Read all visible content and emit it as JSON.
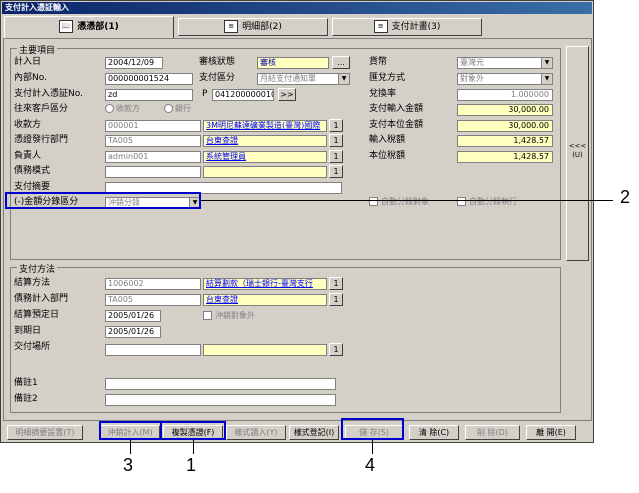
{
  "window": {
    "title": "支付計入憑証輸入"
  },
  "tabs": [
    {
      "label": "憑憑部(1)",
      "icon": "book-icon"
    },
    {
      "label": "明細部(2)",
      "icon": "document-icon"
    },
    {
      "label": "支付計畫(3)",
      "icon": "document-icon"
    }
  ],
  "main_group": {
    "title": "主要項目",
    "labels": {
      "entry_date": "計入日",
      "internal_no": "內部No.",
      "payment_no": "支付計入憑証No.",
      "trade_dist": "往來客戶區分",
      "payee": "收款方",
      "dept": "憑證發行部門",
      "person": "負責人",
      "voucher_mode": "債務模式",
      "summary": "支付摘要",
      "split": "(-)金額分錄區分",
      "review": "審核狀態",
      "pay_dist": "支付區分",
      "p": "P",
      "currency": "貨幣",
      "fx_method": "匯兌方式",
      "fx_rate": "兌換率",
      "pay_amount": "支付輸入金額",
      "local_amount": "支付本位金額",
      "input_tax": "輸入稅額",
      "local_tax": "本位稅額"
    },
    "values": {
      "entry_date": "2004/12/09",
      "internal_no": "000000001524",
      "payment_no": "zd",
      "trade_radio_1": "收款方",
      "trade_radio_2": "銀行",
      "payee_code": "000001",
      "payee_name": "3M明尼蘇達礦業製造(臺灣)國際",
      "dept_code": "TA005",
      "dept_name": "台東查證",
      "person_code": "admin001",
      "person_name": "系統管理員",
      "voucher_mode": "",
      "summary": "",
      "split": "沖銷分錄",
      "review": "審核",
      "pay_dist": "月結支付通知單",
      "p_value": "041200000010",
      "currency": "臺灣元",
      "fx_method": "對象外",
      "fx_rate": "1.000000",
      "pay_amount": "30,000.00",
      "local_amount": "30,000.00",
      "input_tax": "1,428.57",
      "local_tax": "1,428.57",
      "auto_split_1": "自動分錄對象",
      "auto_split_2": "自動分錄執行"
    }
  },
  "pay_group": {
    "title": "支付方法",
    "labels": {
      "method": "結算方法",
      "dept": "債務計入部門",
      "plan_date": "結算預定日",
      "due_date": "到期日",
      "location": "交付場所",
      "note1": "備註1",
      "note2": "備註2"
    },
    "values": {
      "method_code": "1006002",
      "method_name": "結算劃款（瑞士銀行-臺灣支行",
      "dept_code": "TA005",
      "dept_name": "台東查證",
      "plan_date": "2005/01/26",
      "due_date": "2005/01/26",
      "location": "",
      "offset_chk": "沖銷對象外",
      "note1": "",
      "note2": ""
    }
  },
  "side_button": {
    "label": "<<< (U)"
  },
  "lookup_label": "1",
  "ellipsis_label": "...",
  "more_label": ">>",
  "buttons": [
    {
      "label": "明細摘要設置(T)"
    },
    {
      "label": "沖銷計入(M)"
    },
    {
      "label": "複製憑證(F)"
    },
    {
      "label": "樣式讀入(Y)"
    },
    {
      "label": "樣式登記(I)"
    },
    {
      "label": "儲 存(S)"
    },
    {
      "label": "清 除(C)"
    },
    {
      "label": "削 除(D)"
    },
    {
      "label": "離 開(E)"
    }
  ],
  "callouts": [
    "1",
    "2",
    "3",
    "4"
  ],
  "colors": {
    "highlight": "#0000cc",
    "yellow_field": "#ffffc0",
    "title_bar": "#0a246a"
  }
}
